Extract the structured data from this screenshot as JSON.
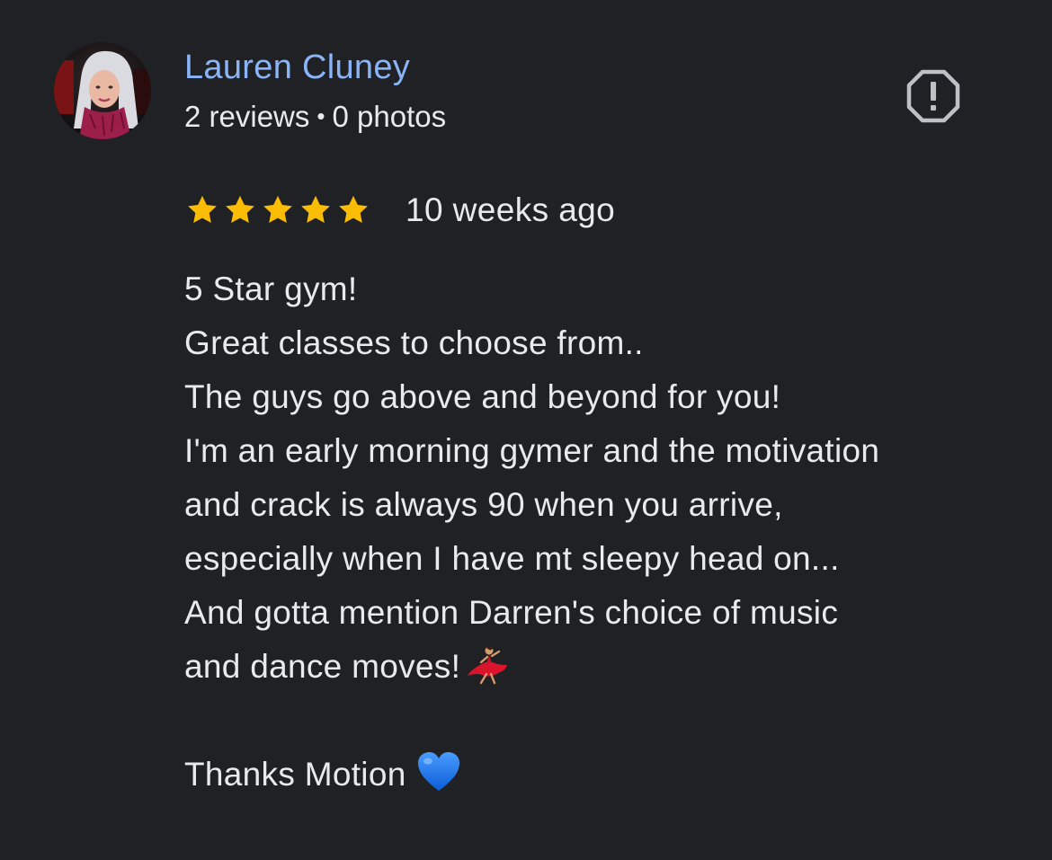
{
  "reviewer": {
    "name": "Lauren Cluney",
    "reviews_count": "2 reviews",
    "separator": "•",
    "photos_count": "0 photos",
    "avatar_icon": "profile-photo"
  },
  "actions": {
    "report_icon": "report-flag-icon"
  },
  "review": {
    "rating": 5,
    "max_rating": 5,
    "time": "10 weeks ago",
    "lines": [
      "5 Star gym!",
      "Great classes to choose from..",
      "The guys go above and beyond for you!",
      "I'm an early morning gymer and the motivation",
      "and crack is always 90 when you arrive,",
      "especially when I have mt sleepy head on...",
      "And gotta mention Darren's choice of music",
      "and dance moves!"
    ],
    "closing": "Thanks Motion"
  },
  "colors": {
    "background": "#202124",
    "name": "#8ab4f8",
    "text": "#e8eaed",
    "star": "#fbbc04",
    "heart": "#1a73e8"
  }
}
